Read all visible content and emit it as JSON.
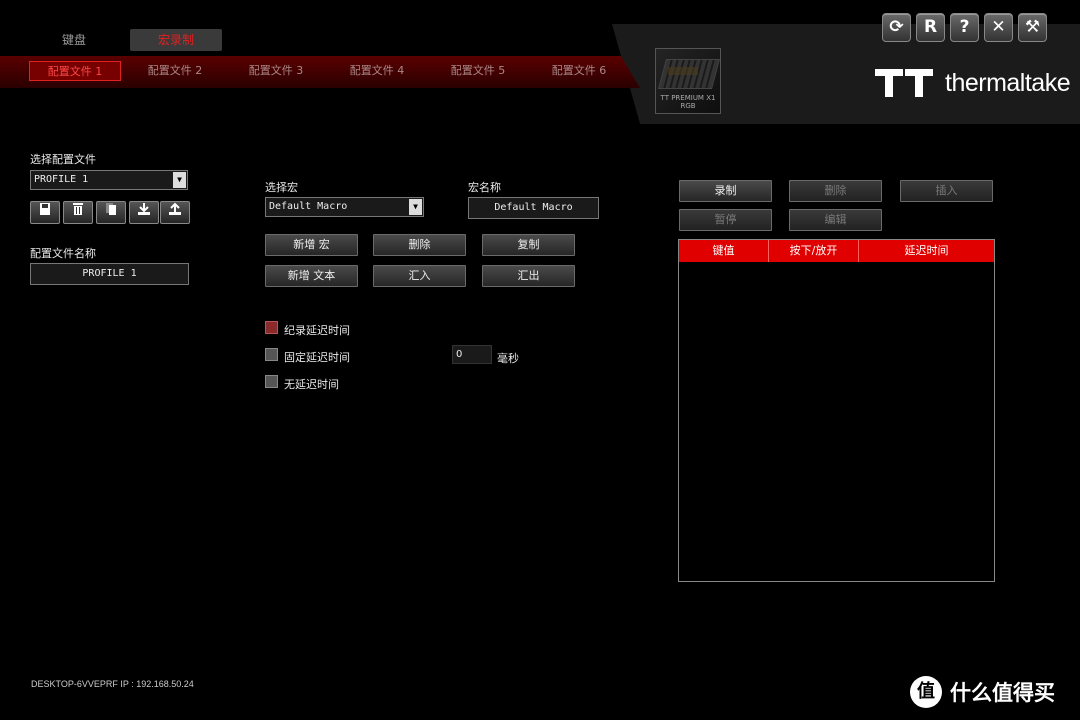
{
  "window_controls": [
    {
      "name": "refresh-icon",
      "glyph": "⟳"
    },
    {
      "name": "reset-icon",
      "glyph": "R"
    },
    {
      "name": "help-icon",
      "glyph": "?"
    },
    {
      "name": "close-icon",
      "glyph": "✕"
    },
    {
      "name": "settings-icon",
      "glyph": "⚒"
    }
  ],
  "main_tabs": {
    "keyboard": "键盘",
    "macro": "宏录制"
  },
  "profile_tabs": [
    "配置文件 1",
    "配置文件 2",
    "配置文件 3",
    "配置文件 4",
    "配置文件 5",
    "配置文件 6"
  ],
  "device": {
    "caption_line1": "TT PREMIUM X1",
    "caption_line2": "RGB"
  },
  "brand": {
    "name": "thermaltake"
  },
  "left": {
    "select_profile_label": "选择配置文件",
    "select_profile_value": "PROFILE 1",
    "profile_name_label": "配置文件名称",
    "profile_name_value": "PROFILE 1",
    "icon_buttons": [
      "save-icon",
      "delete-icon",
      "copy-icon",
      "import-icon",
      "export-icon"
    ]
  },
  "middle": {
    "select_macro_label": "选择宏",
    "select_macro_value": "Default Macro",
    "macro_name_label": "宏名称",
    "macro_name_value": "Default Macro",
    "buttons": {
      "new_macro": "新增 宏",
      "delete": "删除",
      "copy": "复制",
      "new_text": "新增 文本",
      "import": "汇入",
      "export": "汇出"
    },
    "options": {
      "record_delay": "纪录延迟时间",
      "fixed_delay": "固定延迟时间",
      "no_delay": "无延迟时间",
      "fixed_delay_value": "0",
      "unit": "毫秒"
    }
  },
  "right": {
    "buttons": {
      "record": "录制",
      "delete": "删除",
      "insert": "插入",
      "pause": "暂停",
      "edit": "编辑"
    },
    "table_headers": [
      "键值",
      "按下/放开",
      "延迟时间"
    ]
  },
  "footer": {
    "host_info": "DESKTOP-6VVEPRF IP : 192.168.50.24"
  },
  "watermark": {
    "symbol": "值",
    "text": "什么值得买"
  },
  "colors": {
    "accent": "#e00000",
    "bg": "#000000"
  }
}
